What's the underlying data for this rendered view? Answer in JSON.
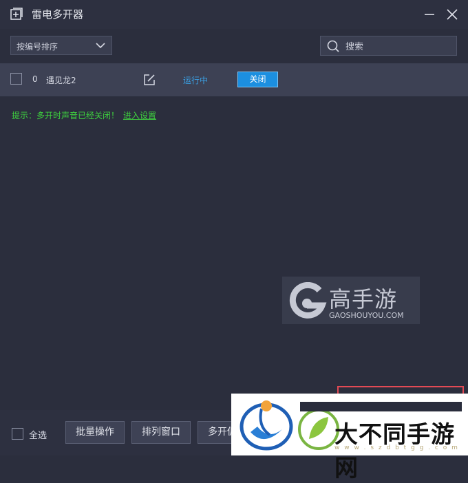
{
  "window": {
    "title": "雷电多开器",
    "icon": "add-window-icon",
    "controls": [
      "minimize-icon",
      "close-icon"
    ]
  },
  "toolbar": {
    "sort_selected": "按编号排序",
    "search_placeholder": "搜索"
  },
  "instances": [
    {
      "checked": false,
      "index": "0",
      "name": "遇见龙2",
      "status": "运行中",
      "action_label": "关闭"
    }
  ],
  "tip": {
    "text": "提示：多开时声音已经关闭！",
    "link": "进入设置"
  },
  "watermark_gaoshouyou": {
    "text_cn": "高手游",
    "text_en": "GAOSHOUYOU.COM"
  },
  "footer": {
    "select_all_label": "全选",
    "batch_label": "批量操作",
    "arrange_label": "排列窗口",
    "multi_label": "多开仮"
  },
  "watermark_site": {
    "text": "大不同手游网",
    "url": "w w w . s z d b t g g . c o m"
  },
  "colors": {
    "background": "#2b2e3d",
    "row_background": "#3d4154",
    "status_blue": "#3aa0e4",
    "button_blue": "#1c8fe0",
    "tip_green": "#3ed13e",
    "frame_red": "#e34a55"
  }
}
